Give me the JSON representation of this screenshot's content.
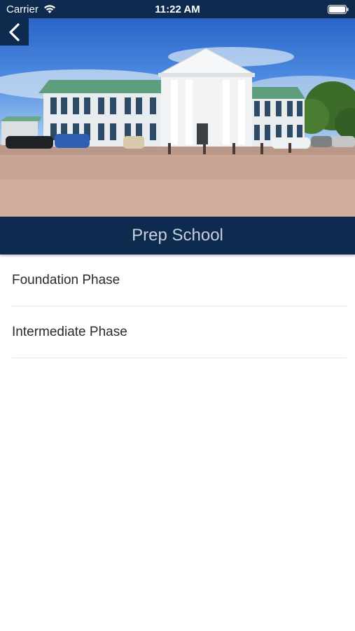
{
  "status_bar": {
    "carrier": "Carrier",
    "time": "11:22 AM"
  },
  "header": {
    "title": "Prep School"
  },
  "menu": {
    "items": [
      {
        "label": "Foundation Phase"
      },
      {
        "label": "Intermediate Phase"
      }
    ]
  },
  "icons": {
    "back": "chevron-left-icon",
    "wifi": "wifi-icon",
    "battery": "battery-icon"
  },
  "colors": {
    "nav_background": "#0e2a4e",
    "title_text": "#c5d0dd",
    "list_text": "#2b2b2b"
  }
}
